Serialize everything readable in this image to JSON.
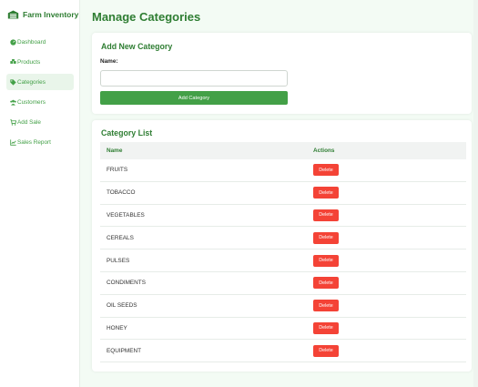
{
  "app": {
    "title": "Farm Inventory"
  },
  "sidebar": {
    "items": [
      {
        "label": "Dashboard",
        "icon": "gauge-icon"
      },
      {
        "label": "Products",
        "icon": "boxes-icon"
      },
      {
        "label": "Categories",
        "icon": "tag-icon",
        "active": true
      },
      {
        "label": "Customers",
        "icon": "users-icon"
      },
      {
        "label": "Add Sale",
        "icon": "cart-icon"
      },
      {
        "label": "Sales Report",
        "icon": "chart-icon"
      }
    ]
  },
  "page": {
    "title": "Manage Categories"
  },
  "add_form": {
    "title": "Add New Category",
    "name_label": "Name:",
    "name_value": "",
    "submit_label": "Add Category"
  },
  "list": {
    "title": "Category List",
    "headers": {
      "name": "Name",
      "actions": "Actions"
    },
    "delete_label": "Delete",
    "rows": [
      {
        "name": "FRUITS"
      },
      {
        "name": "TOBACCO"
      },
      {
        "name": "VEGETABLES"
      },
      {
        "name": "CEREALS"
      },
      {
        "name": "PULSES"
      },
      {
        "name": "CONDIMENTS"
      },
      {
        "name": "OIL SEEDS"
      },
      {
        "name": "HONEY"
      },
      {
        "name": "EQUIPMENT"
      }
    ]
  },
  "colors": {
    "brand": "#2e7d32",
    "accent": "#43a047",
    "danger": "#f44336"
  }
}
